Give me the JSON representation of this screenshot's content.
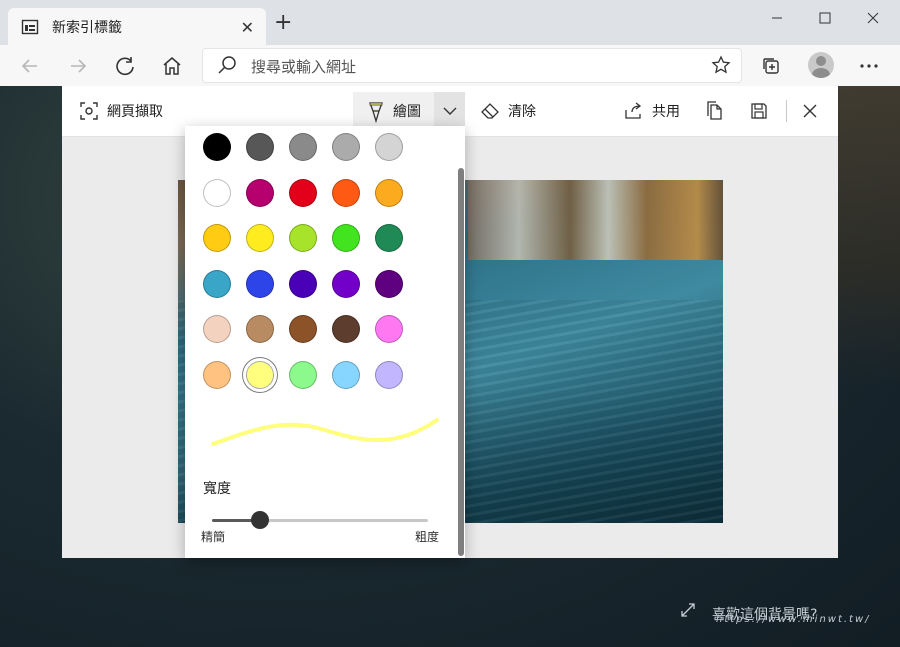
{
  "browser": {
    "tab_title": "新索引標籤",
    "address_placeholder": "搜尋或輸入網址"
  },
  "capture": {
    "title": "網頁擷取",
    "draw_label": "繪圖",
    "erase_label": "清除",
    "share_label": "共用"
  },
  "pen_menu": {
    "colors": [
      "#000000",
      "#575757",
      "#8a8a8a",
      "#ababab",
      "#d4d4d4",
      "#ffffff",
      "#b5006e",
      "#e3001b",
      "#ff5a14",
      "#fcaa1e",
      "#ffcc13",
      "#ffec1f",
      "#a6e32a",
      "#41e41f",
      "#1f8a56",
      "#39a5c7",
      "#2d44e8",
      "#4a00b6",
      "#7200c9",
      "#5e007f",
      "#f3d3c0",
      "#b88b62",
      "#8c5228",
      "#5d3d2e",
      "#ff78f2",
      "#ffc280",
      "#ffff7d",
      "#8bf98b",
      "#87d6ff",
      "#c1b6ff"
    ],
    "selected_color": "#ffff7d",
    "width_label": "寬度",
    "thin_label": "精簡",
    "thick_label": "粗度",
    "width_value_percent": 22
  },
  "page": {
    "edge_text": "喜歡這個背景嗎?",
    "site_watermark": "https://www.minwt.tw/"
  }
}
